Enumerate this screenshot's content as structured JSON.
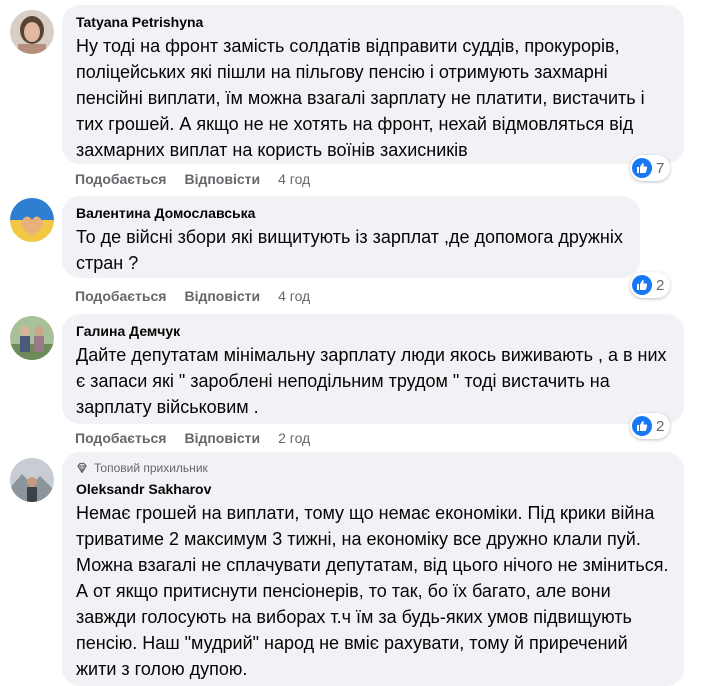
{
  "colors": {
    "bubble": "#f0f2f5",
    "secondary_text": "#65676b",
    "like_blue": "#1877f2"
  },
  "actions": {
    "like": "Подобається",
    "reply": "Відповісти"
  },
  "comments": [
    {
      "author": "Tatyana Petrishyna",
      "text": "Ну тоді на фронт замість солдатів відправити суддів, прокурорів, поліцейських які пішли на пільгову пенсію і отримують захмарні пенсійні виплати, їм можна взагалі зарплату не платити, вистачить і тих грошей. А якщо не не хотять на фронт, нехай відмовляться від захмарних виплат на користь воїнів захисників",
      "time": "4 год",
      "reactions": "7",
      "reaction_icon": "like-icon"
    },
    {
      "author": "Валентина Домославська",
      "text": "То де війсні збори які вищитують із зарплат ,де допомога дружніх стран ?",
      "time": "4 год",
      "reactions": "2",
      "reaction_icon": "like-icon"
    },
    {
      "author": "Галина Демчук",
      "text": "Дайте депутатам мінімальну зарплату люди якось виживають , а в них є запаси які \" зароблені неподільним трудом \" тоді вистачить на зарплату військовим .",
      "time": "2 год",
      "reactions": "2",
      "reaction_icon": "like-icon"
    },
    {
      "badge": "Топовий прихильник",
      "badge_icon": "diamond-icon",
      "author": "Oleksandr Sakharov",
      "text": "Немає грошей на виплати, тому що немає економіки. Під крики війна триватиме 2 максимум 3 тижні, на економіку все дружно клали пуй. Можна взагалі не сплачувати депутатам, від цього нічого не зміниться. А от якщо притиснути пенсіонерів, то так, бо їх багато, але вони завжди голосують на виборах т.ч їм за будь-яких умов підвищують пенсію. Наш \"мудрий\" народ не вміє рахувати, тому й приречений жити з голою дупою."
    }
  ]
}
